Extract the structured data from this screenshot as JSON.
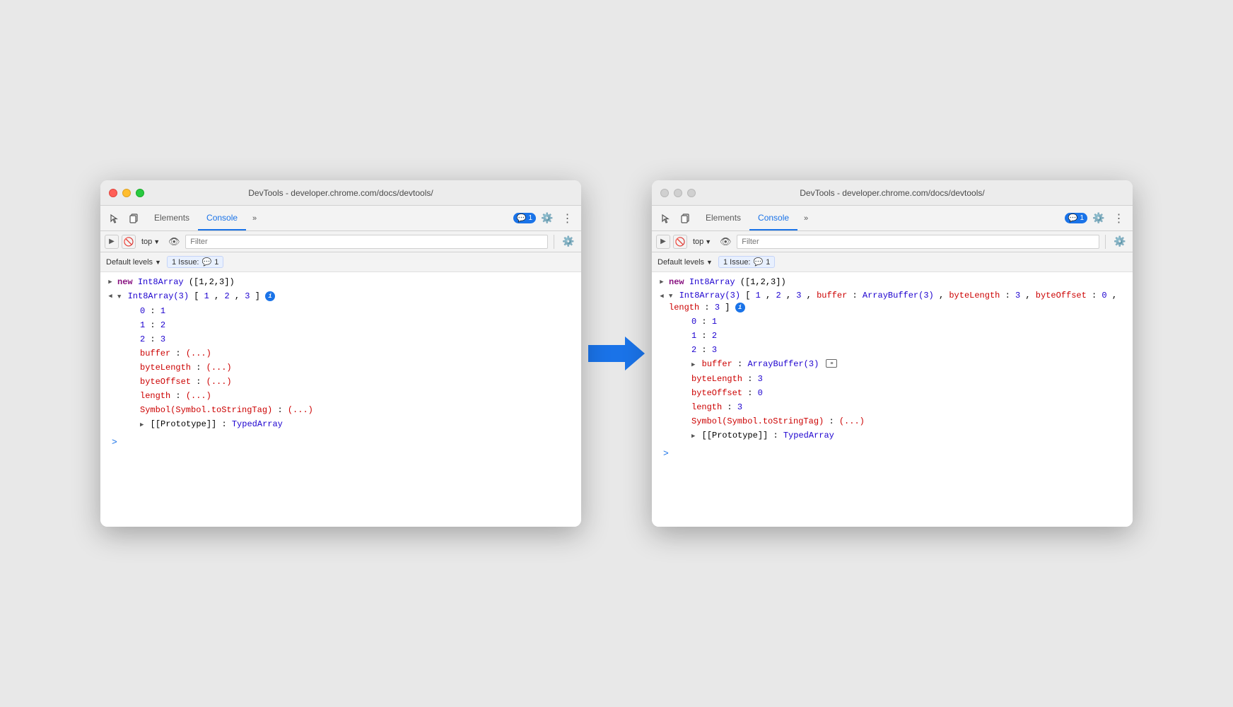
{
  "left_window": {
    "title": "DevTools - developer.chrome.com/docs/devtools/",
    "traffic_lights": "active",
    "tabs": [
      {
        "label": "Elements",
        "active": false
      },
      {
        "label": "Console",
        "active": true
      }
    ],
    "more_tabs": "»",
    "notification": "1",
    "toolbar_icons": [
      "cursor-icon",
      "copy-icon",
      "gear-icon",
      "more-icon"
    ],
    "console_toolbar": {
      "top_label": "top",
      "filter_placeholder": "Filter",
      "eye_icon": true,
      "gear_icon": true
    },
    "levels": {
      "label": "Default levels",
      "issue_label": "1 Issue:",
      "issue_count": "1"
    },
    "console_lines": [
      {
        "type": "command",
        "content": "new Int8Array([1,2,3])"
      },
      {
        "type": "result_header",
        "content": "Int8Array(3) [1, 2, 3]",
        "expanded": true
      },
      {
        "type": "prop",
        "indent": 2,
        "key": "0:",
        "value": "1"
      },
      {
        "type": "prop",
        "indent": 2,
        "key": "1:",
        "value": "2"
      },
      {
        "type": "prop",
        "indent": 2,
        "key": "2:",
        "value": "3"
      },
      {
        "type": "lazy",
        "indent": 2,
        "key": "buffer:",
        "value": "(...)"
      },
      {
        "type": "lazy",
        "indent": 2,
        "key": "byteLength:",
        "value": "(...)"
      },
      {
        "type": "lazy",
        "indent": 2,
        "key": "byteOffset:",
        "value": "(...)"
      },
      {
        "type": "lazy",
        "indent": 2,
        "key": "length:",
        "value": "(...)"
      },
      {
        "type": "lazy",
        "indent": 2,
        "key": "Symbol(Symbol.toStringTag):",
        "value": "(...)"
      },
      {
        "type": "proto",
        "indent": 2,
        "content": "[[Prototype]]: TypedArray"
      }
    ],
    "prompt": ">"
  },
  "right_window": {
    "title": "DevTools - developer.chrome.com/docs/devtools/",
    "traffic_lights": "inactive",
    "tabs": [
      {
        "label": "Elements",
        "active": false
      },
      {
        "label": "Console",
        "active": true
      }
    ],
    "more_tabs": "»",
    "notification": "1",
    "console_toolbar": {
      "top_label": "top",
      "filter_placeholder": "Filter"
    },
    "levels": {
      "label": "Default levels",
      "issue_label": "1 Issue:",
      "issue_count": "1"
    },
    "console_lines": [
      {
        "type": "command",
        "content": "new Int8Array([1,2,3])"
      },
      {
        "type": "result_header_long",
        "content": "Int8Array(3) [1, 2, 3, buffer: ArrayBuffer(3), byteLength: 3, byteOffset: 0, length: 3]",
        "expanded": true,
        "red_arrow": true
      },
      {
        "type": "prop",
        "indent": 2,
        "key": "0:",
        "value": "1"
      },
      {
        "type": "prop",
        "indent": 2,
        "key": "1:",
        "value": "2"
      },
      {
        "type": "prop",
        "indent": 2,
        "key": "2:",
        "value": "3"
      },
      {
        "type": "buffer_prop",
        "indent": 2,
        "key": "buffer:",
        "value": "ArrayBuffer(3)",
        "red_arrow": true
      },
      {
        "type": "plain",
        "indent": 2,
        "key": "byteLength:",
        "value": "3"
      },
      {
        "type": "plain",
        "indent": 2,
        "key": "byteOffset:",
        "value": "0"
      },
      {
        "type": "plain",
        "indent": 2,
        "key": "length:",
        "value": "3"
      },
      {
        "type": "lazy",
        "indent": 2,
        "key": "Symbol(Symbol.toStringTag):",
        "value": "(...)"
      },
      {
        "type": "proto",
        "indent": 2,
        "content": "[[Prototype]]: TypedArray"
      }
    ],
    "prompt": ">"
  },
  "arrow": {
    "color": "#1a73e8",
    "direction": "right"
  }
}
